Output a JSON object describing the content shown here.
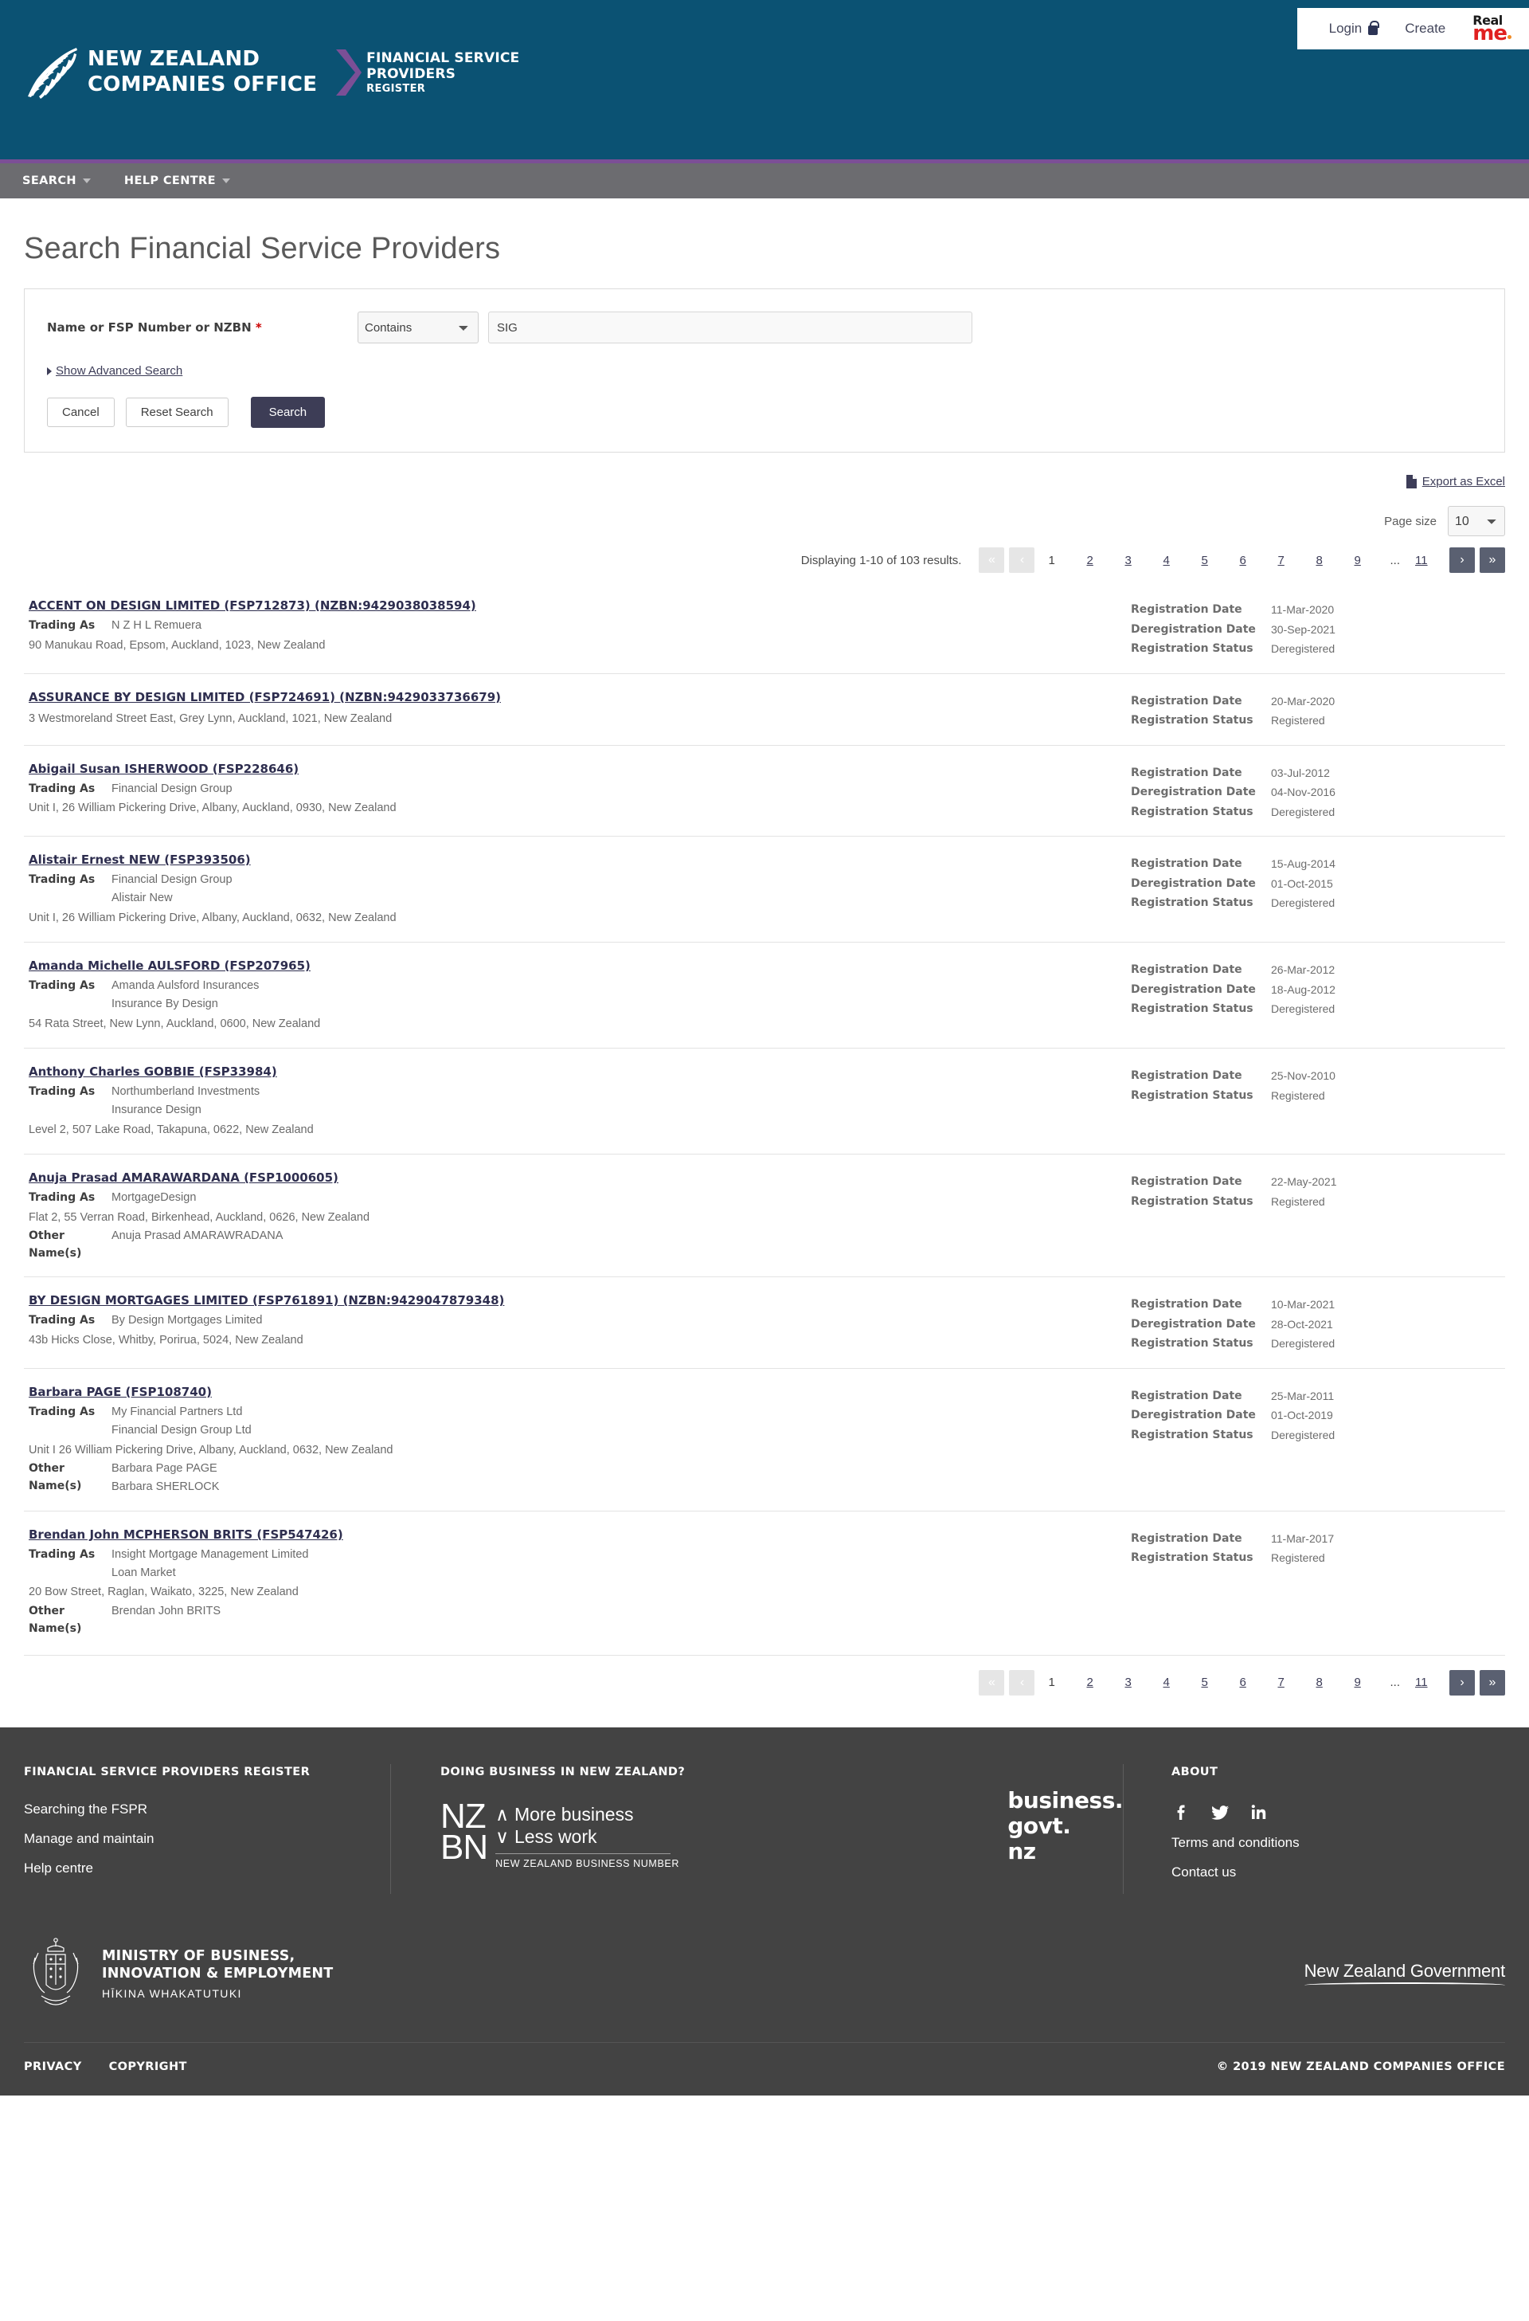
{
  "header": {
    "login_label": "Login",
    "create_label": "Create",
    "realme": {
      "top": "Real",
      "bottom": "me"
    },
    "brand_left_line1": "NEW ZEALAND",
    "brand_left_line2": "COMPANIES OFFICE",
    "brand_right_line1": "FINANCIAL SERVICE",
    "brand_right_line2": "PROVIDERS",
    "brand_right_line3": "REGISTER"
  },
  "nav": {
    "items": [
      {
        "label": "SEARCH"
      },
      {
        "label": "HELP CENTRE"
      }
    ]
  },
  "page": {
    "title": "Search Financial Service Providers"
  },
  "search_form": {
    "field_label": "Name or FSP Number or NZBN",
    "required_marker": "*",
    "match_mode": "Contains",
    "match_options": [
      "Contains"
    ],
    "query_value": "SIG",
    "advanced_toggle": "Show Advanced Search",
    "cancel_label": "Cancel",
    "reset_label": "Reset Search",
    "search_label": "Search"
  },
  "results_toolbar": {
    "export_label": "Export as Excel",
    "page_size_label": "Page size",
    "page_size_value": "10",
    "page_size_options": [
      "10"
    ],
    "displaying": "Displaying 1-10 of 103 results."
  },
  "pagination": {
    "first_icon": "«",
    "prev_icon": "‹",
    "next_icon": "›",
    "last_icon": "»",
    "pages": [
      "1",
      "2",
      "3",
      "4",
      "5",
      "6",
      "7",
      "8",
      "9"
    ],
    "ellipsis": "...",
    "last_page": "11",
    "current": "1"
  },
  "labels": {
    "trading_as": "Trading As",
    "other_names": "Other Name(s)",
    "registration_date": "Registration Date",
    "deregistration_date": "Deregistration Date",
    "registration_status": "Registration Status"
  },
  "results": [
    {
      "title": "ACCENT ON DESIGN LIMITED (FSP712873) (NZBN:9429038038594)",
      "trading_as": [
        "N Z H L Remuera"
      ],
      "address": "90 Manukau Road, Epsom, Auckland, 1023, New Zealand",
      "other_names": [],
      "registration_date": "11-Mar-2020",
      "deregistration_date": "30-Sep-2021",
      "registration_status": "Deregistered"
    },
    {
      "title": "ASSURANCE BY DESIGN LIMITED (FSP724691) (NZBN:9429033736679)",
      "trading_as": [],
      "address": "3 Westmoreland Street East, Grey Lynn, Auckland, 1021, New Zealand",
      "other_names": [],
      "registration_date": "20-Mar-2020",
      "deregistration_date": "",
      "registration_status": "Registered"
    },
    {
      "title": "Abigail Susan ISHERWOOD (FSP228646)",
      "trading_as": [
        "Financial Design Group"
      ],
      "address": "Unit I, 26 William Pickering Drive, Albany, Auckland, 0930, New Zealand",
      "other_names": [],
      "registration_date": "03-Jul-2012",
      "deregistration_date": "04-Nov-2016",
      "registration_status": "Deregistered"
    },
    {
      "title": "Alistair Ernest NEW (FSP393506)",
      "trading_as": [
        "Financial Design Group",
        "Alistair New"
      ],
      "address": "Unit I, 26 William Pickering Drive, Albany, Auckland, 0632, New Zealand",
      "other_names": [],
      "registration_date": "15-Aug-2014",
      "deregistration_date": "01-Oct-2015",
      "registration_status": "Deregistered"
    },
    {
      "title": "Amanda Michelle AULSFORD (FSP207965)",
      "trading_as": [
        "Amanda Aulsford Insurances",
        "Insurance By Design"
      ],
      "address": "54 Rata Street, New Lynn, Auckland, 0600, New Zealand",
      "other_names": [],
      "registration_date": "26-Mar-2012",
      "deregistration_date": "18-Aug-2012",
      "registration_status": "Deregistered"
    },
    {
      "title": "Anthony Charles GOBBIE (FSP33984)",
      "trading_as": [
        "Northumberland Investments",
        "Insurance Design"
      ],
      "address": "Level 2, 507 Lake Road, Takapuna, 0622, New Zealand",
      "other_names": [],
      "registration_date": "25-Nov-2010",
      "deregistration_date": "",
      "registration_status": "Registered"
    },
    {
      "title": "Anuja Prasad AMARAWARDANA (FSP1000605)",
      "trading_as": [
        "MortgageDesign"
      ],
      "address": "Flat 2, 55 Verran Road, Birkenhead, Auckland, 0626, New Zealand",
      "other_names": [
        "Anuja Prasad AMARAWRADANA"
      ],
      "registration_date": "22-May-2021",
      "deregistration_date": "",
      "registration_status": "Registered"
    },
    {
      "title": "BY DESIGN MORTGAGES LIMITED (FSP761891) (NZBN:9429047879348)",
      "trading_as": [
        "By Design Mortgages Limited"
      ],
      "address": "43b Hicks Close, Whitby, Porirua, 5024, New Zealand",
      "other_names": [],
      "registration_date": "10-Mar-2021",
      "deregistration_date": "28-Oct-2021",
      "registration_status": "Deregistered"
    },
    {
      "title": "Barbara PAGE (FSP108740)",
      "trading_as": [
        "My Financial Partners Ltd",
        "Financial Design Group Ltd"
      ],
      "address": "Unit I 26 William Pickering Drive, Albany, Auckland, 0632, New Zealand",
      "other_names": [
        "Barbara Page PAGE",
        "Barbara SHERLOCK"
      ],
      "registration_date": "25-Mar-2011",
      "deregistration_date": "01-Oct-2019",
      "registration_status": "Deregistered"
    },
    {
      "title": "Brendan John MCPHERSON BRITS (FSP547426)",
      "trading_as": [
        "Insight Mortgage Management Limited",
        "Loan Market"
      ],
      "address": "20 Bow Street, Raglan, Waikato, 3225, New Zealand",
      "other_names": [
        "Brendan John BRITS"
      ],
      "registration_date": "11-Mar-2017",
      "deregistration_date": "",
      "registration_status": "Registered"
    }
  ],
  "footer": {
    "col1_heading": "FINANCIAL SERVICE PROVIDERS REGISTER",
    "col1_links": [
      "Searching the FSPR",
      "Manage and maintain",
      "Help centre"
    ],
    "col2_heading": "DOING BUSINESS IN NEW ZEALAND?",
    "nzbn": {
      "line1": "NZ",
      "line2": "BN",
      "tag1": "More business",
      "tag2": "Less work",
      "sub": "NEW ZEALAND BUSINESS NUMBER"
    },
    "businessgovt": {
      "l1": "business.",
      "l2": "govt.",
      "l3": "nz"
    },
    "col3_heading": "ABOUT",
    "social": [
      "facebook-icon",
      "twitter-icon",
      "linkedin-icon"
    ],
    "col3_links": [
      "Terms and conditions",
      "Contact us"
    ],
    "mbie_line1": "MINISTRY OF BUSINESS,",
    "mbie_line2": "INNOVATION & EMPLOYMENT",
    "mbie_maori": "HĪKINA WHAKATUTUKI",
    "nz_govt": "New Zealand Government",
    "privacy": "PRIVACY",
    "copyright_link": "COPYRIGHT",
    "copyright_text": "© 2019 NEW ZEALAND COMPANIES OFFICE"
  },
  "colors": {
    "header_blue": "#0b5273",
    "nav_grey": "#6c6c70",
    "accent_purple": "#7b4f96",
    "primary_button": "#3d3d56",
    "link_navy": "#3d3d58",
    "footer_dark": "#434343"
  }
}
